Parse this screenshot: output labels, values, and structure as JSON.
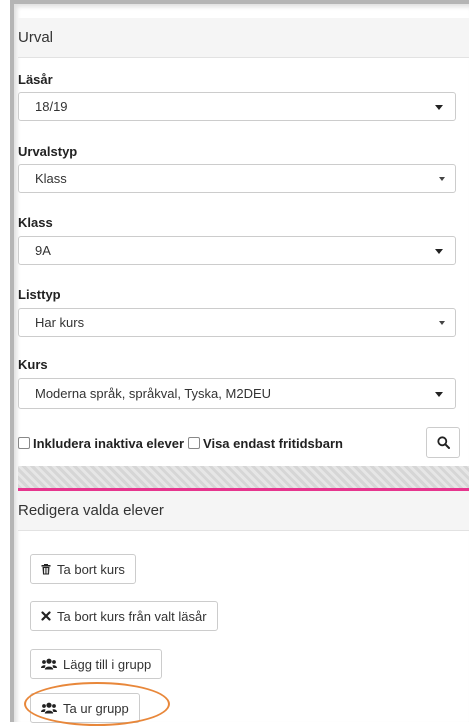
{
  "selection": {
    "title": "Urval",
    "lasar": {
      "label": "Läsår",
      "value": "18/19"
    },
    "urvalstyp": {
      "label": "Urvalstyp",
      "value": "Klass"
    },
    "klass": {
      "label": "Klass",
      "value": "9A"
    },
    "listtyp": {
      "label": "Listtyp",
      "value": "Har kurs"
    },
    "kurs": {
      "label": "Kurs",
      "value": "Moderna språk, språkval, Tyska, M2DEU"
    },
    "include_inactive_label": "Inkludera inaktiva elever",
    "only_leisure_label": "Visa endast fritidsbarn",
    "search_icon": "search-icon"
  },
  "edit": {
    "title": "Redigera valda elever",
    "remove_course_label": "Ta bort kurs",
    "remove_course_year_label": "Ta bort kurs från valt läsår",
    "add_to_group_label": "Lägg till i grupp",
    "remove_from_group_label": "Ta ur grupp"
  },
  "colors": {
    "accent_divider": "#e6358e",
    "highlight_ring": "#e8873a"
  }
}
